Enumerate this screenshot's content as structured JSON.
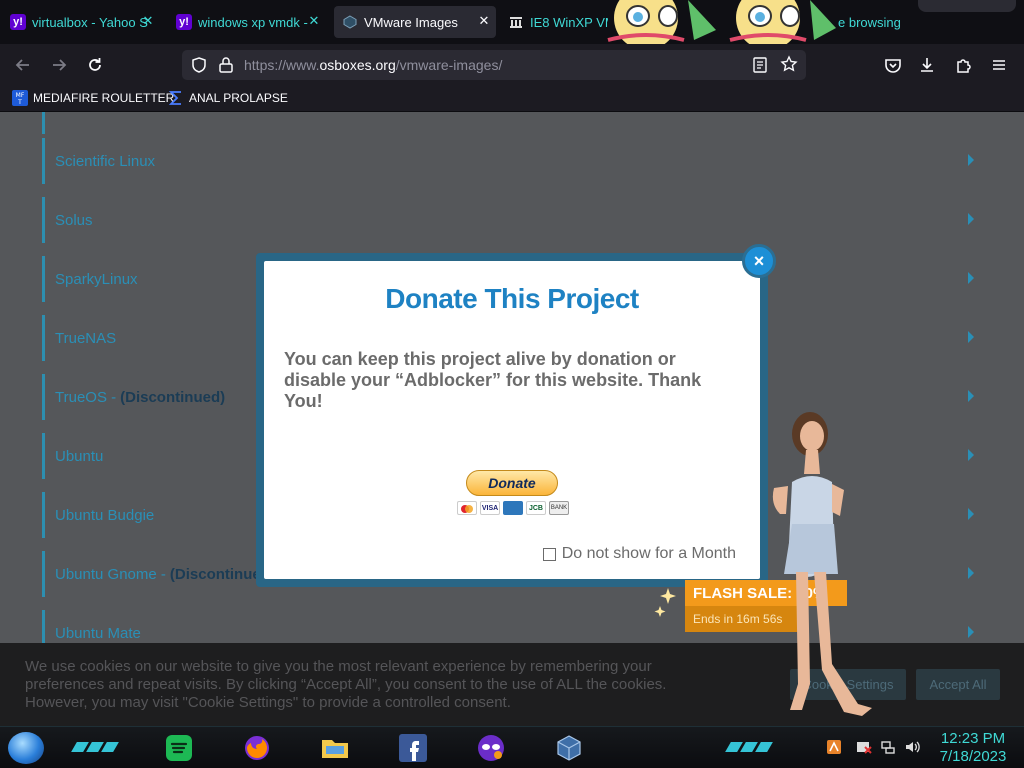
{
  "browser": {
    "tabs": [
      {
        "title": "virtualbox - Yahoo S",
        "favicon": "yahoo-icon",
        "active": false
      },
      {
        "title": "windows xp vmdk -",
        "favicon": "yahoo-icon",
        "active": false
      },
      {
        "title": "VMware Images",
        "favicon": "osboxes-icon",
        "active": true
      },
      {
        "title": "IE8 WinXP VM",
        "favicon": "archive-icon",
        "active": false
      },
      {
        "title": "e browsing",
        "favicon": "",
        "active": false
      }
    ],
    "tab_close_glyph": "✕",
    "url": {
      "prefix": "https://www.",
      "host": "osboxes.org",
      "path": "/vmware-images/"
    },
    "bookmarks": [
      {
        "label": "MEDIAFIRE ROULETTER",
        "icon": "mediafire-icon"
      },
      {
        "label": "ANAL PROLAPSE",
        "icon": "sigma-icon"
      }
    ]
  },
  "page": {
    "distros": [
      {
        "name": "Scientific Linux",
        "suffix": ""
      },
      {
        "name": "Solus",
        "suffix": ""
      },
      {
        "name": "SparkyLinux",
        "suffix": ""
      },
      {
        "name": "TrueNAS",
        "suffix": ""
      },
      {
        "name": "TrueOS - ",
        "suffix": "(Discontinued)"
      },
      {
        "name": "Ubuntu",
        "suffix": ""
      },
      {
        "name": "Ubuntu Budgie",
        "suffix": ""
      },
      {
        "name": "Ubuntu Gnome - ",
        "suffix": "(Discontinued)"
      },
      {
        "name": "Ubuntu Mate",
        "suffix": ""
      }
    ]
  },
  "modal": {
    "title": "Donate This Project",
    "message": "You can keep this project alive by donation or disable your “Adblocker” for this website. Thank You!",
    "donate_label": "Donate",
    "payment_cards": [
      "mastercard",
      "visa",
      "amex",
      "jcb",
      "bank"
    ],
    "card_labels": {
      "visa": "VISA",
      "jcb": "JCB",
      "bank": "BANK"
    },
    "dont_show": "Do not show for a Month",
    "close_glyph": "×"
  },
  "ad": {
    "flash_sale": "FLASH SALE: 10%",
    "ends": "Ends in 16m 56s"
  },
  "cookie": {
    "text": "We use cookies on our website to give you the most relevant experience by remembering your preferences and repeat visits. By clicking “Accept All”, you consent to the use of ALL the cookies. However, you may visit \"Cookie Settings\" to provide a controlled consent.",
    "settings_label": "Cookie Settings",
    "accept_label": "Accept All"
  },
  "taskbar": {
    "apps": [
      "spotify-icon",
      "firefox-icon",
      "file-explorer-icon",
      "facebook-icon",
      "mask-app-icon",
      "virtualbox-icon"
    ],
    "time": "12:23 PM",
    "date": "7/18/2023",
    "colors": {
      "accent": "#3fd9d5"
    }
  },
  "colors": {
    "modal_title": "#1e82c3",
    "flash": "#f39a1b",
    "link": "#2a8fb6"
  }
}
